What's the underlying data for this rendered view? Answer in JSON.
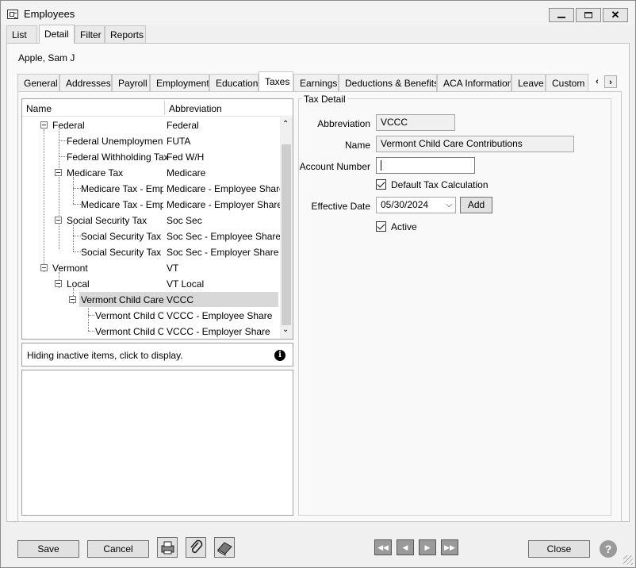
{
  "window": {
    "title": "Employees",
    "minimize_icon": "minimize-icon",
    "restore_icon": "restore-icon",
    "close_icon": "close-icon"
  },
  "top_tabs": [
    "List",
    "Detail",
    "Filter",
    "Reports"
  ],
  "employee_name": "Apple, Sam J",
  "sub_tabs": [
    "General",
    "Addresses",
    "Payroll",
    "Employment",
    "Education",
    "Taxes",
    "Earnings",
    "Deductions & Benefits",
    "ACA Information",
    "Leave",
    "Custom F"
  ],
  "tree": {
    "col_name": "Name",
    "col_abbrev": "Abbreviation",
    "rows": [
      {
        "name": "Federal",
        "abbrev": "Federal"
      },
      {
        "name": "Federal Unemployment...",
        "abbrev": "FUTA"
      },
      {
        "name": "Federal Withholding Tax",
        "abbrev": "Fed W/H"
      },
      {
        "name": "Medicare Tax",
        "abbrev": "Medicare"
      },
      {
        "name": "Medicare Tax - Emp...",
        "abbrev": "Medicare - Employee Share"
      },
      {
        "name": "Medicare Tax - Emp...",
        "abbrev": "Medicare - Employer Share"
      },
      {
        "name": "Social Security Tax",
        "abbrev": "Soc Sec"
      },
      {
        "name": "Social Security Tax ...",
        "abbrev": "Soc Sec - Employee Share"
      },
      {
        "name": "Social Security Tax ...",
        "abbrev": "Soc Sec - Employer Share"
      },
      {
        "name": "Vermont",
        "abbrev": "VT"
      },
      {
        "name": "Local",
        "abbrev": "VT Local"
      },
      {
        "name": "Vermont Child Care...",
        "abbrev": "VCCC"
      },
      {
        "name": "Vermont Child C...",
        "abbrev": "VCCC - Employee Share"
      },
      {
        "name": "Vermont Child C...",
        "abbrev": "VCCC - Employer Share"
      }
    ]
  },
  "inactive_notice": "Hiding inactive items, click to display.",
  "detail": {
    "legend": "Tax Detail",
    "abbrev_label": "Abbreviation",
    "abbrev_value": "VCCC",
    "name_label": "Name",
    "name_value": "Vermont Child Care Contributions",
    "account_label": "Account Number",
    "account_value": "",
    "default_calc_label": "Default Tax Calculation",
    "effective_label": "Effective Date",
    "effective_value": "05/30/2024",
    "add_label": "Add",
    "active_label": "Active"
  },
  "footer": {
    "save": "Save",
    "cancel": "Cancel",
    "close": "Close",
    "help": "?"
  }
}
